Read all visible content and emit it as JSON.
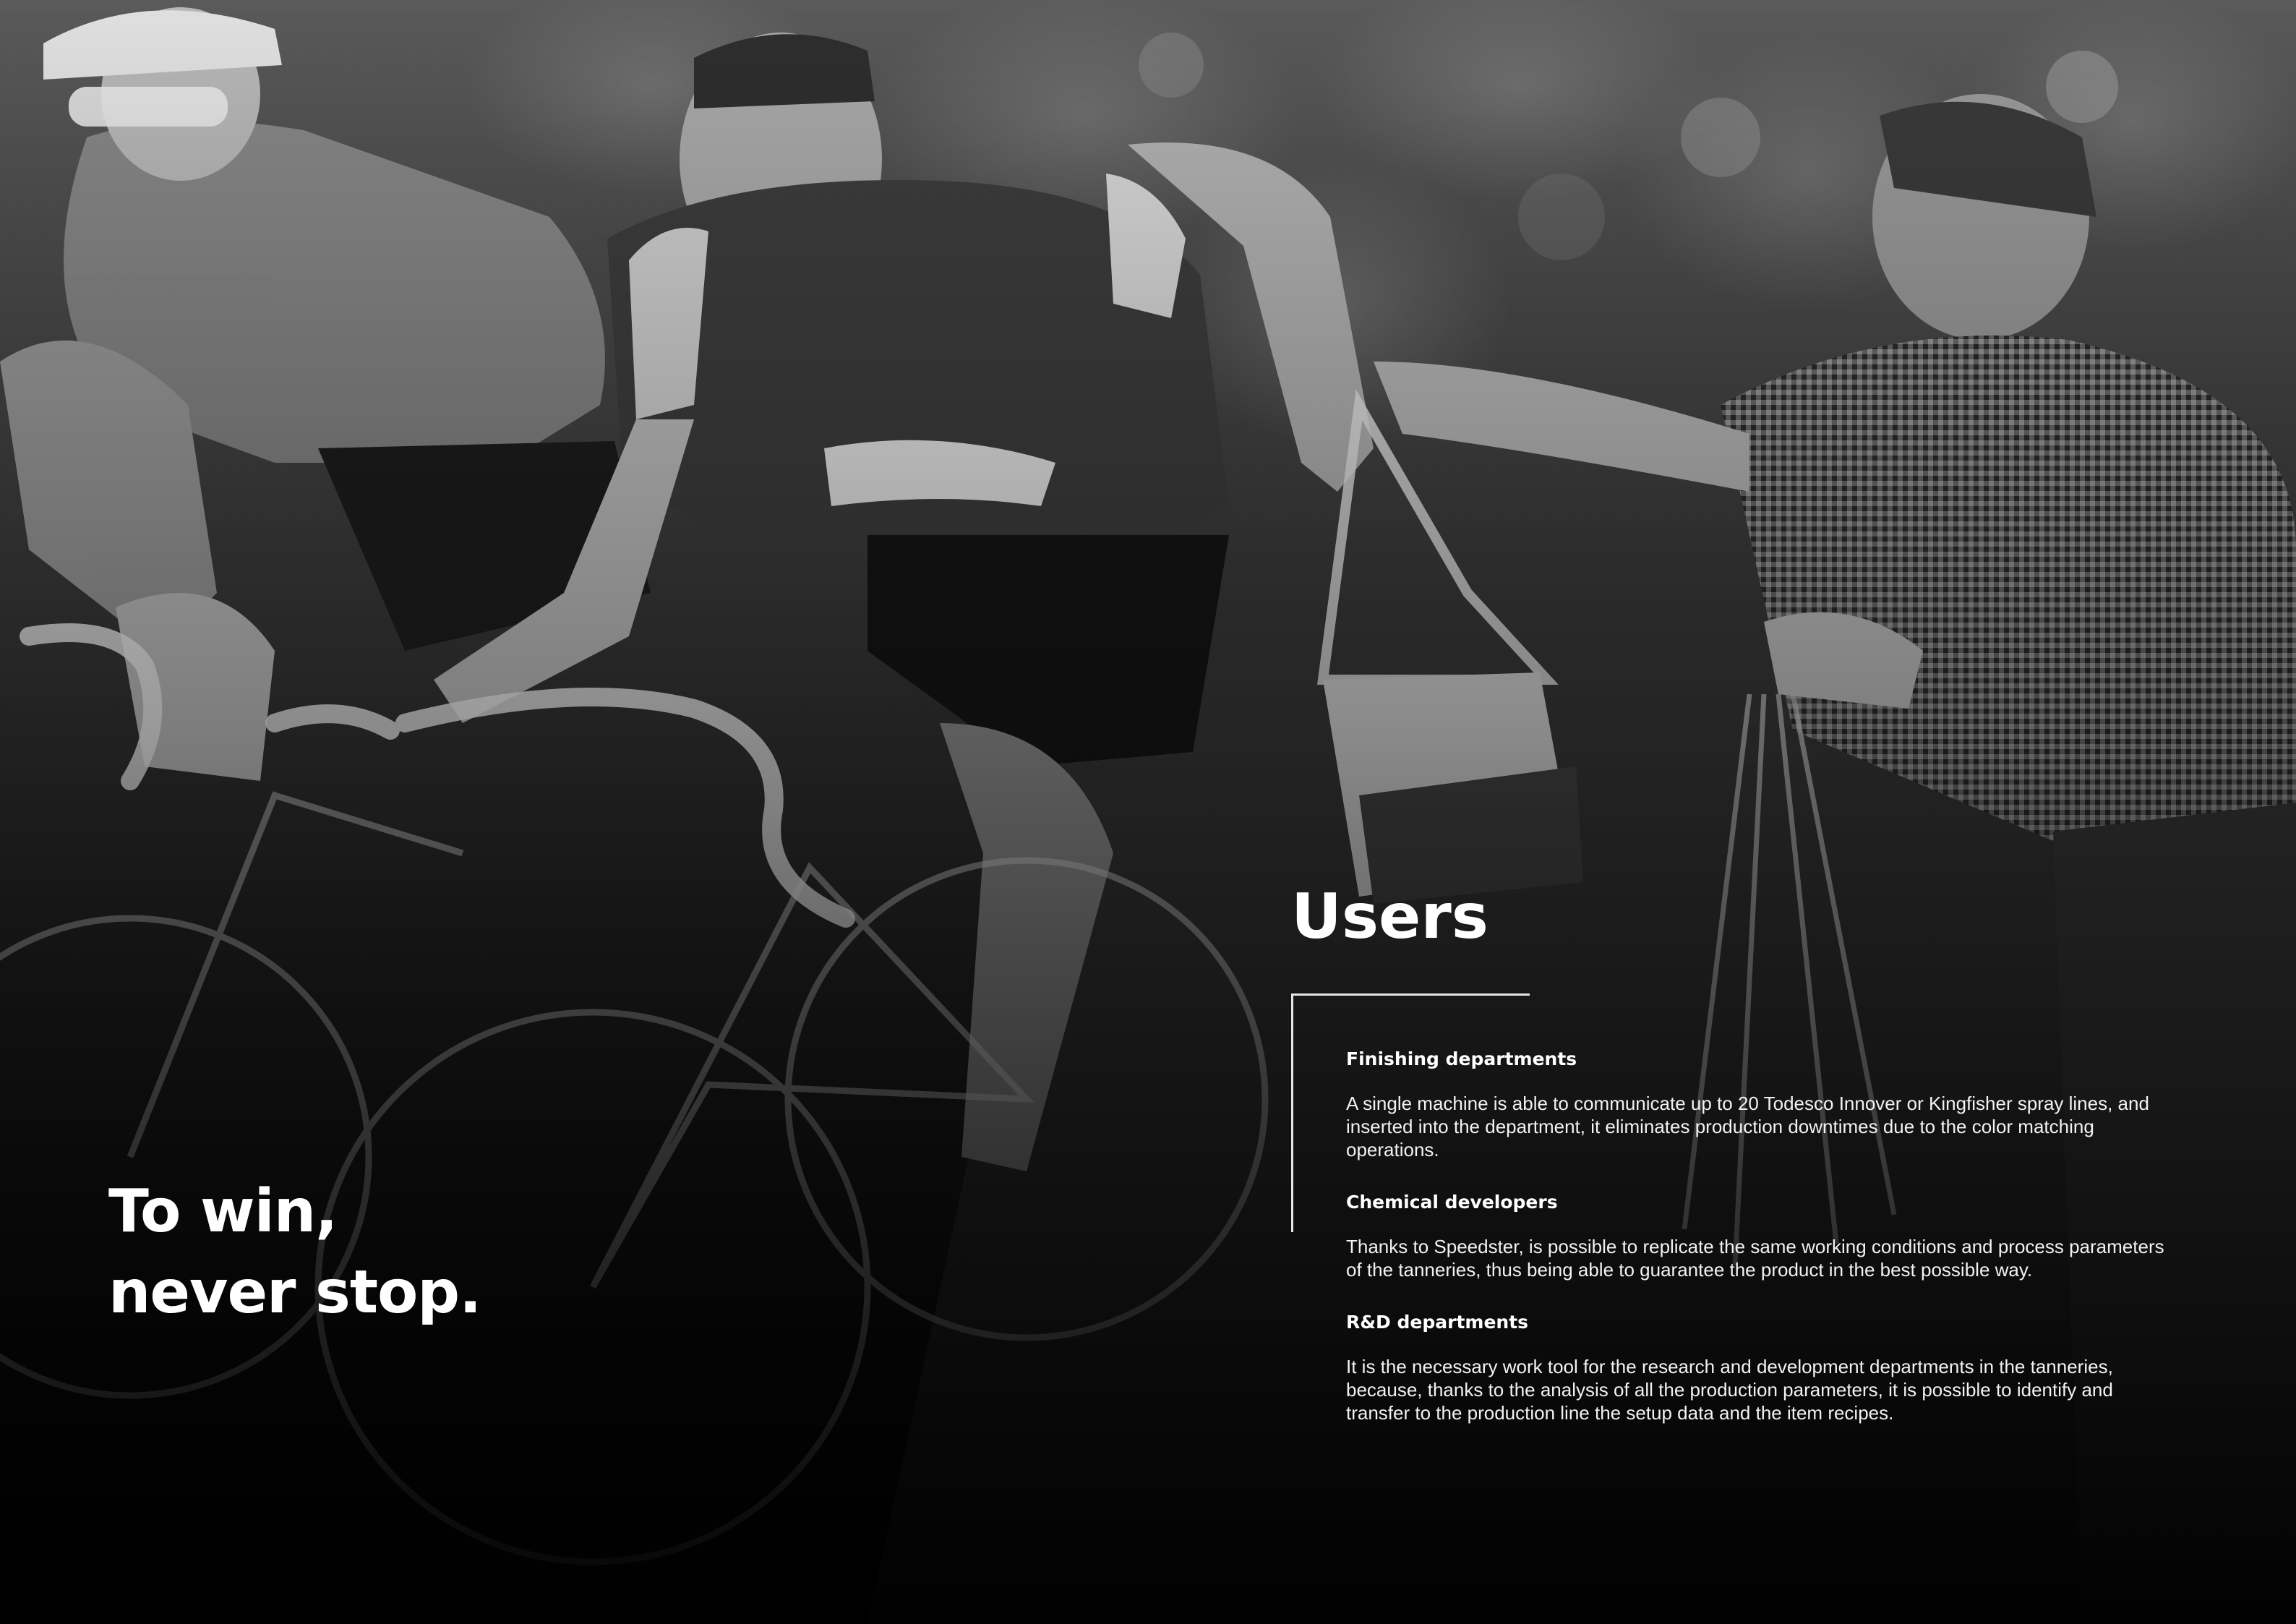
{
  "hero": {
    "slogan_line1": "To win,",
    "slogan_line2": "never stop.",
    "photo_name": "vintage-cycling-race-photo"
  },
  "users": {
    "title": "Users",
    "sections": [
      {
        "heading": "Finishing departments",
        "body": "A single machine is able to communicate up to 20 Todesco Innover or Kingfisher spray lines, and inserted into the department, it eliminates production downtimes due to the color matching operations."
      },
      {
        "heading": "Chemical developers",
        "body": "Thanks to Speedster, is possible to replicate the same working conditions and process parameters of the tanneries, thus being able to guarantee the product in the best possible way."
      },
      {
        "heading": "R&D departments",
        "body": "It is the necessary work tool for the research and development departments in the tanneries, because, thanks to the analysis of all the production parameters, it is possible to identify and transfer to the production line the setup data and the item recipes."
      }
    ]
  },
  "colors": {
    "text": "#ffffff",
    "background": "#000000",
    "accent_line": "#e6e6e6"
  }
}
